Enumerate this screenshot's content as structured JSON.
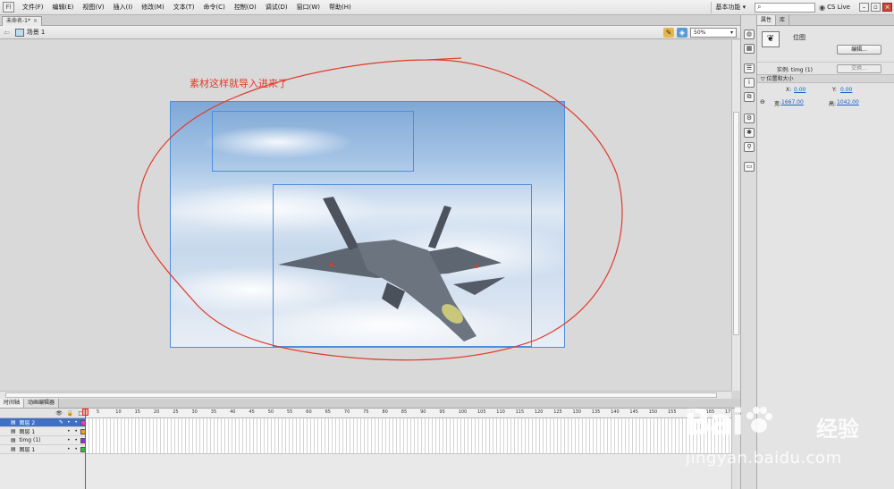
{
  "menu": {
    "logo": "Fl",
    "items": [
      "文件(F)",
      "编辑(E)",
      "视图(V)",
      "插入(I)",
      "修改(M)",
      "文本(T)",
      "命令(C)",
      "控制(O)",
      "调试(D)",
      "窗口(W)",
      "帮助(H)"
    ],
    "workspace": "基本功能 ▾",
    "search_placeholder": "",
    "cs_live": "CS Live"
  },
  "document": {
    "tab_title": "未命名-1*",
    "tab_close": "×"
  },
  "editbar": {
    "scene": "场景 1",
    "zoom": "50%"
  },
  "stage": {
    "annotation": "素材这样就导入进来了"
  },
  "timeline": {
    "tabs": [
      "时间轴",
      "动画编辑器"
    ],
    "header_icons": [
      "👁",
      "🔒",
      "□"
    ],
    "frame_numbers": [
      "5",
      "10",
      "15",
      "20",
      "25",
      "30",
      "35",
      "40",
      "45",
      "50",
      "55",
      "60",
      "65",
      "70",
      "75",
      "80",
      "85",
      "90",
      "95",
      "100",
      "105",
      "110",
      "115",
      "120",
      "125",
      "130",
      "135",
      "140",
      "145",
      "150",
      "155",
      "160",
      "165",
      "17"
    ],
    "layers": [
      {
        "name": "图层 2",
        "selected": true,
        "color": "#e040c0"
      },
      {
        "name": "图层 1",
        "selected": false,
        "color": "#f0a020"
      },
      {
        "name": "timg (1)",
        "selected": false,
        "color": "#9030e0"
      },
      {
        "name": "图层 1",
        "selected": false,
        "color": "#30c040"
      }
    ]
  },
  "properties": {
    "tabs": [
      "属性",
      "库"
    ],
    "symbol_type": "位图",
    "edit_button": "编辑...",
    "instance_label": "实例:  timg (1)",
    "swap_button": "交换...",
    "position_section": "▽ 位置和大小",
    "x_label": "X:",
    "x_value": "0.00",
    "y_label": "Y:",
    "y_value": "0.00",
    "w_label": "宽:",
    "w_value": "1667.00",
    "h_label": "高:",
    "h_value": "1042.00"
  },
  "watermark": {
    "logo": "Bai",
    "brand": "经验",
    "url": "jingyan.baidu.com"
  },
  "colors": {
    "selection_blue": "#4d8ee0",
    "annotation_red": "#e23a2a",
    "link_blue": "#1f5fc7"
  }
}
